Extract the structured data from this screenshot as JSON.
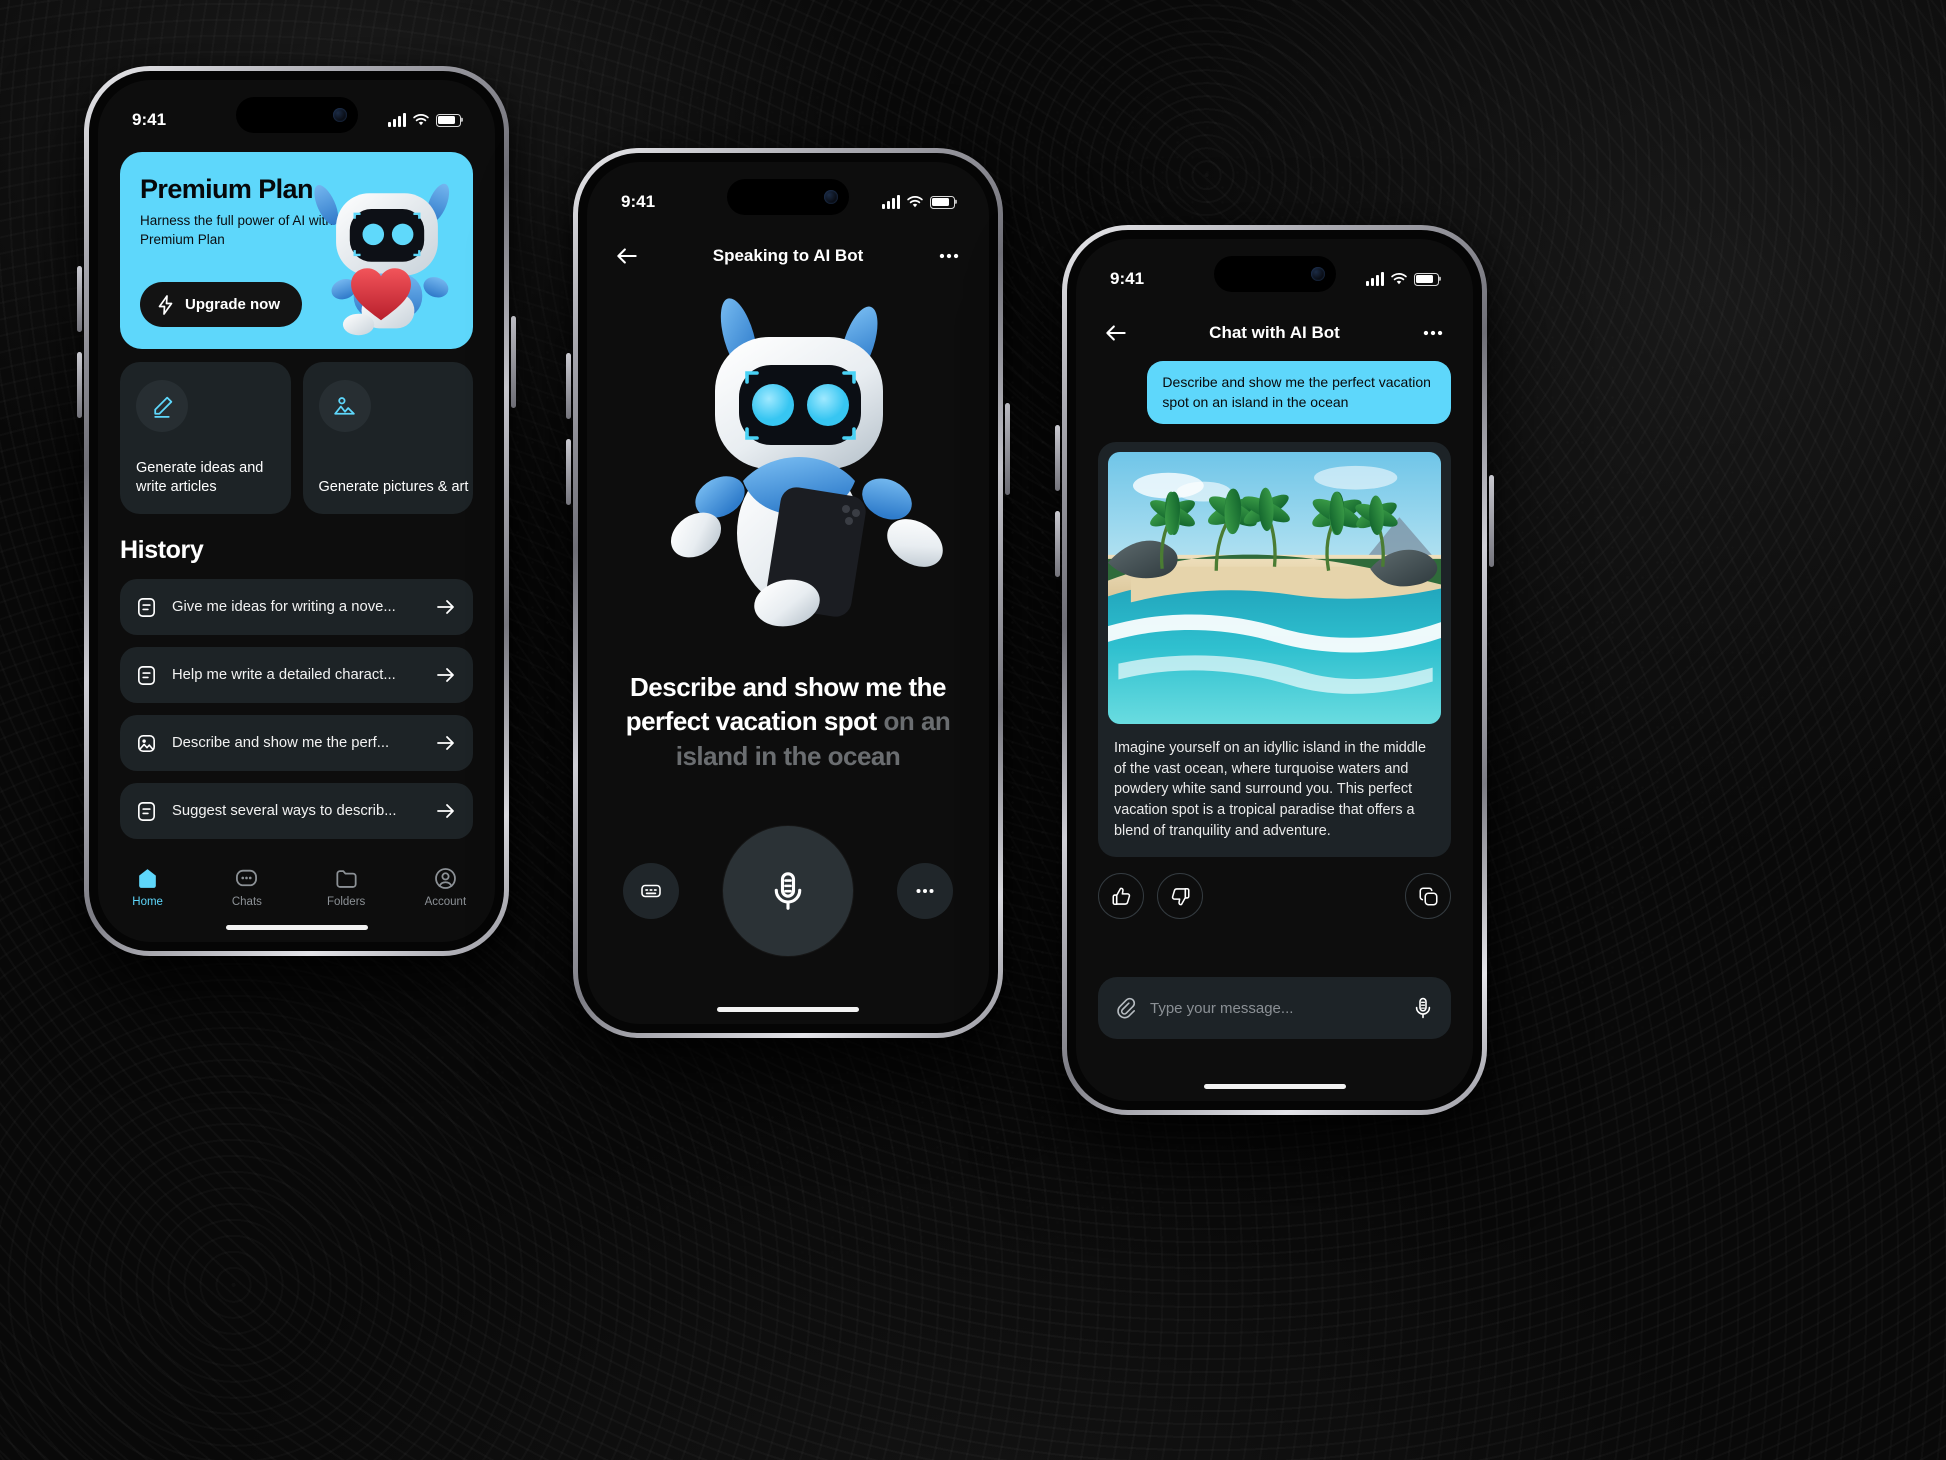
{
  "colors": {
    "accent": "#5ed7fb",
    "card": "#1d2326",
    "screen_bg": "#0d0d0d",
    "dim_text": "#6a6d70"
  },
  "phone_home": {
    "status": {
      "time": "9:41"
    },
    "promo": {
      "title": "Premium Plan",
      "subtitle": "Harness the full power of AI with a Premium Plan",
      "button_label": "Upgrade now",
      "button_icon": "lightning-bolt-icon",
      "art": "robot-holding-heart-illustration"
    },
    "feature_cards": [
      {
        "icon": "pencil-edit-icon",
        "label": "Generate ideas and write articles"
      },
      {
        "icon": "image-picture-icon",
        "label": "Generate pictures & art"
      }
    ],
    "history": {
      "title": "History",
      "items": [
        {
          "icon": "document-text-icon",
          "text": "Give me ideas for writing a nove...",
          "action_icon": "arrow-right-icon"
        },
        {
          "icon": "document-text-icon",
          "text": "Help me write a detailed charact...",
          "action_icon": "arrow-right-icon"
        },
        {
          "icon": "image-picture-icon",
          "text": "Describe and show me the perf...",
          "action_icon": "arrow-right-icon"
        },
        {
          "icon": "document-text-icon",
          "text": "Suggest several ways to describ...",
          "action_icon": "arrow-right-icon"
        }
      ]
    },
    "tabbar": [
      {
        "icon": "home-icon",
        "label": "Home",
        "active": true
      },
      {
        "icon": "chat-bubble-icon",
        "label": "Chats",
        "active": false
      },
      {
        "icon": "folder-icon",
        "label": "Folders",
        "active": false
      },
      {
        "icon": "account-user-icon",
        "label": "Account",
        "active": false
      }
    ]
  },
  "phone_voice": {
    "status": {
      "time": "9:41"
    },
    "header": {
      "back_icon": "arrow-left-icon",
      "title": "Speaking to AI Bot",
      "menu_icon": "more-horizontal-icon"
    },
    "hero_art": "robot-holding-phone-illustration",
    "caption": {
      "spoken": "Describe and show me the perfect vacation spot",
      "pending": "on an island in the ocean"
    },
    "controls": {
      "left_icon": "keyboard-icon",
      "mic_icon": "microphone-icon",
      "right_icon": "more-horizontal-icon"
    }
  },
  "phone_chat": {
    "status": {
      "time": "9:41"
    },
    "header": {
      "back_icon": "arrow-left-icon",
      "title": "Chat with AI Bot",
      "menu_icon": "more-horizontal-icon"
    },
    "user_message": "Describe and show me the perfect vacation spot on an island in the ocean",
    "ai_image": "tropical-island-with-palm-trees-illustration",
    "ai_message": "Imagine yourself on an idyllic island in the middle of the vast ocean, where turquoise waters and powdery white sand surround you. This perfect vacation spot is a tropical paradise that offers a blend of tranquility and adventure.",
    "actions": [
      {
        "icon": "thumbs-up-icon",
        "name": "like"
      },
      {
        "icon": "thumbs-down-icon",
        "name": "dislike"
      },
      {
        "icon": "copy-icon",
        "name": "copy"
      }
    ],
    "composer": {
      "attach_icon": "paperclip-icon",
      "placeholder": "Type your message...",
      "mic_icon": "microphone-icon"
    }
  }
}
